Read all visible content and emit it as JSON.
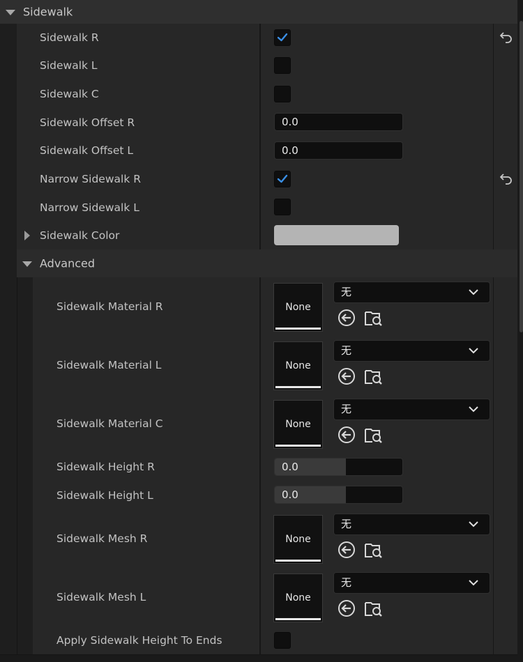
{
  "section": {
    "label": "Sidewalk"
  },
  "advanced": {
    "label": "Advanced"
  },
  "rows": [
    {
      "label": "Sidewalk R"
    },
    {
      "label": "Sidewalk L"
    },
    {
      "label": "Sidewalk C"
    },
    {
      "label": "Sidewalk Offset R",
      "value": "0.0"
    },
    {
      "label": "Sidewalk Offset L",
      "value": "0.0"
    },
    {
      "label": "Narrow Sidewalk R"
    },
    {
      "label": "Narrow Sidewalk L"
    },
    {
      "label": "Sidewalk Color"
    }
  ],
  "checks": {
    "sidewalk_r": true,
    "sidewalk_l": false,
    "sidewalk_c": false,
    "narrow_r": true,
    "narrow_l": false,
    "apply_ends": false
  },
  "asset_rows": [
    {
      "label": "Sidewalk Material R",
      "thumb": "None",
      "combo": "无"
    },
    {
      "label": "Sidewalk Material L",
      "thumb": "None",
      "combo": "无"
    },
    {
      "label": "Sidewalk Material C",
      "thumb": "None",
      "combo": "无"
    },
    {
      "label": "Sidewalk Mesh R",
      "thumb": "None",
      "combo": "无"
    },
    {
      "label": "Sidewalk Mesh L",
      "thumb": "None",
      "combo": "无"
    }
  ],
  "height_rows": [
    {
      "label": "Sidewalk Height R",
      "value": "0.0"
    },
    {
      "label": "Sidewalk Height L",
      "value": "0.0"
    }
  ],
  "apply_row": {
    "label": "Apply Sidewalk Height To Ends"
  },
  "colors": {
    "check": "#3a8fe6",
    "swatch": "#b4b4b4"
  },
  "icons": {
    "reset": "reset-to-default-icon",
    "use_selected": "use-selected-asset-icon",
    "browse": "browse-asset-icon",
    "dropdown": "chevron-down-icon",
    "expand": "triangle-down-icon",
    "collapse": "triangle-right-icon"
  }
}
